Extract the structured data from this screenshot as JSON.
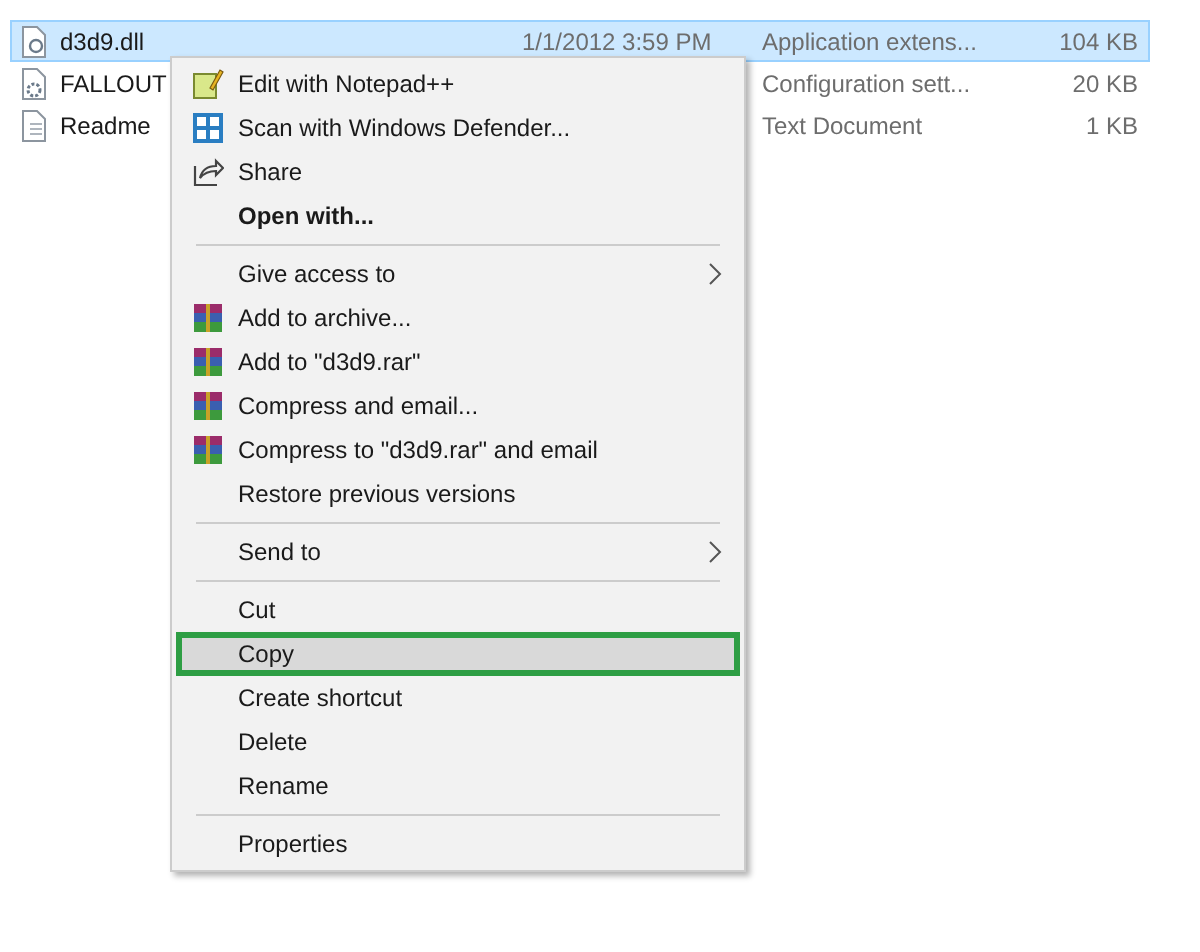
{
  "files": [
    {
      "name": "d3d9.dll",
      "kind": "dll",
      "date": "1/1/2012 3:59 PM",
      "type": "Application extens...",
      "size": "104 KB",
      "selected": true
    },
    {
      "name": "FALLOUT",
      "kind": "config",
      "type": "Configuration sett...",
      "size": "20 KB",
      "selected": false
    },
    {
      "name": "Readme",
      "kind": "text",
      "type": "Text Document",
      "size": "1 KB",
      "selected": false
    }
  ],
  "context_menu": {
    "groups": [
      [
        {
          "label": "Edit with Notepad++",
          "kind": "notepad",
          "bold": false,
          "submenu": false,
          "selected": false
        },
        {
          "label": "Scan with Windows Defender...",
          "kind": "shield",
          "bold": false,
          "submenu": false,
          "selected": false
        },
        {
          "label": "Share",
          "kind": "share",
          "bold": false,
          "submenu": false,
          "selected": false
        },
        {
          "label": "Open with...",
          "kind": "plain",
          "bold": true,
          "submenu": false,
          "selected": false
        }
      ],
      [
        {
          "label": "Give access to",
          "kind": "plain",
          "bold": false,
          "submenu": true,
          "selected": false
        },
        {
          "label": "Add to archive...",
          "kind": "archive",
          "bold": false,
          "submenu": false,
          "selected": false
        },
        {
          "label": "Add to \"d3d9.rar\"",
          "kind": "archive",
          "bold": false,
          "submenu": false,
          "selected": false
        },
        {
          "label": "Compress and email...",
          "kind": "archive",
          "bold": false,
          "submenu": false,
          "selected": false
        },
        {
          "label": "Compress to \"d3d9.rar\" and email",
          "kind": "archive",
          "bold": false,
          "submenu": false,
          "selected": false
        },
        {
          "label": "Restore previous versions",
          "kind": "plain",
          "bold": false,
          "submenu": false,
          "selected": false
        }
      ],
      [
        {
          "label": "Send to",
          "kind": "plain",
          "bold": false,
          "submenu": true,
          "selected": false
        }
      ],
      [
        {
          "label": "Cut",
          "kind": "plain",
          "bold": false,
          "submenu": false,
          "selected": false
        },
        {
          "label": "Copy",
          "kind": "plain",
          "bold": false,
          "submenu": false,
          "selected": true
        },
        {
          "label": "Create shortcut",
          "kind": "plain",
          "bold": false,
          "submenu": false,
          "selected": false
        },
        {
          "label": "Delete",
          "kind": "plain",
          "bold": false,
          "submenu": false,
          "selected": false
        },
        {
          "label": "Rename",
          "kind": "plain",
          "bold": false,
          "submenu": false,
          "selected": false
        }
      ],
      [
        {
          "label": "Properties",
          "kind": "plain",
          "bold": false,
          "submenu": false,
          "selected": false
        }
      ]
    ]
  }
}
